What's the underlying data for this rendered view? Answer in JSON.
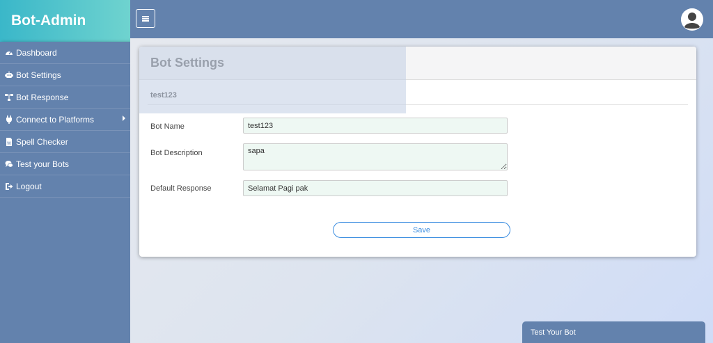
{
  "brand": {
    "title": "Bot-Admin"
  },
  "sidebar": {
    "items": [
      {
        "label": "Dashboard",
        "icon": "dashboard-icon"
      },
      {
        "label": "Bot Settings",
        "icon": "robot-icon"
      },
      {
        "label": "Bot Response",
        "icon": "sitemap-icon"
      },
      {
        "label": "Connect to Platforms",
        "icon": "plug-icon",
        "has_submenu": true
      },
      {
        "label": "Spell Checker",
        "icon": "document-icon"
      },
      {
        "label": "Test your Bots",
        "icon": "chat-icon"
      },
      {
        "label": "Logout",
        "icon": "logout-icon"
      }
    ]
  },
  "main": {
    "card_title": "Bot Settings",
    "bot_id": "test123",
    "fields": {
      "name_label": "Bot Name",
      "name_value": "test123",
      "description_label": "Bot Description",
      "description_value": "sapa",
      "response_label": "Default Response",
      "response_value": "Selamat Pagi pak"
    },
    "save_label": "Save"
  },
  "chat": {
    "label": "Test Your Bot"
  },
  "colors": {
    "sidebar": "#6382ad",
    "brand_start": "#3ab7c9",
    "brand_end": "#6fd3cf",
    "accent": "#3b8de0",
    "field_bg": "#eef8f3"
  }
}
